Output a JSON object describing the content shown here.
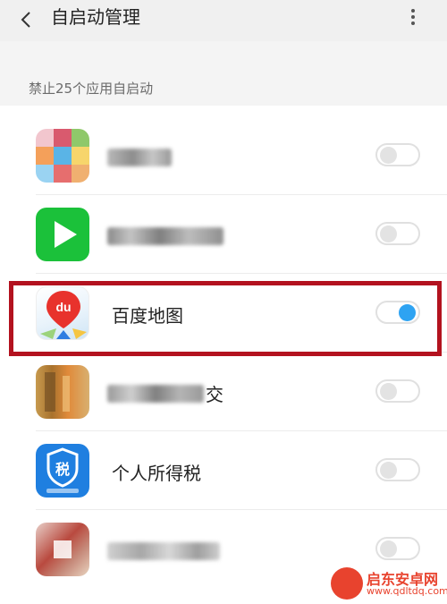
{
  "header": {
    "title": "自启动管理",
    "back_icon": "chevron-left-icon",
    "more_icon": "more-vertical-icon"
  },
  "section_label": "禁止25个应用自启动",
  "apps": [
    {
      "name": "",
      "blurred": true,
      "enabled": false,
      "icon": "blurred-app-icon"
    },
    {
      "name": "",
      "blurred": true,
      "enabled": false,
      "icon": "green-play-icon"
    },
    {
      "name": "百度地图",
      "blurred": false,
      "enabled": true,
      "icon": "baidu-maps-icon",
      "icon_text": "du"
    },
    {
      "name": "交",
      "blurred": true,
      "enabled": false,
      "icon": "blurred-app-icon"
    },
    {
      "name": "个人所得税",
      "blurred": false,
      "enabled": false,
      "icon": "tax-shield-icon",
      "icon_text": "税"
    },
    {
      "name": "",
      "blurred": true,
      "enabled": false,
      "icon": "blurred-app-icon"
    }
  ],
  "colors": {
    "toggle_on": "#2ea3f2",
    "highlight": "#b3121f",
    "watermark": "#e8432e"
  },
  "watermark": {
    "name": "启东安卓网",
    "url": "www.qdltdq.com"
  }
}
